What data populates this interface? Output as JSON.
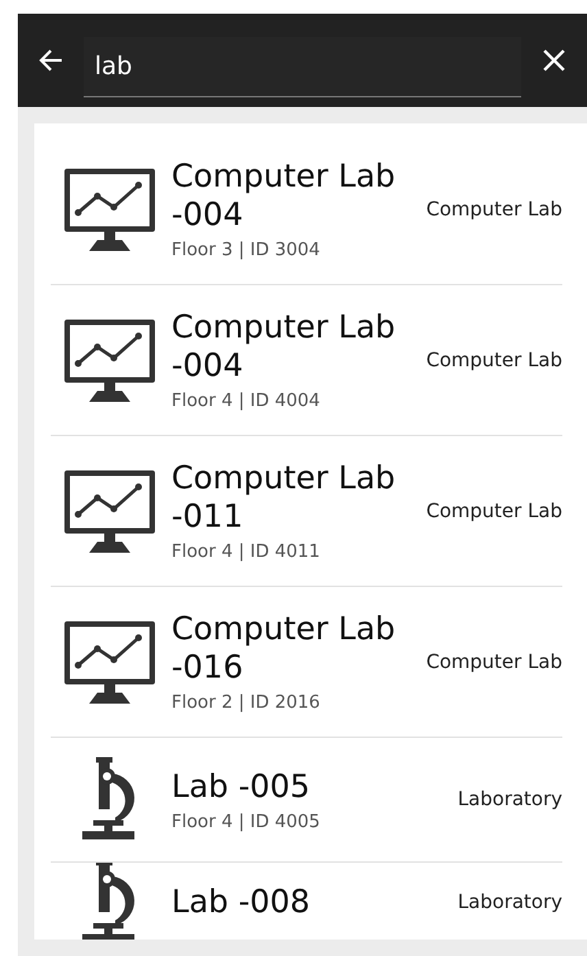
{
  "search": {
    "value": "lab"
  },
  "results": [
    {
      "kind": "computer",
      "title": "Computer Lab -004",
      "subtitle": "Floor 3 | ID 3004",
      "category": "Computer Lab"
    },
    {
      "kind": "computer",
      "title": "Computer Lab -004",
      "subtitle": "Floor 4 | ID 4004",
      "category": "Computer Lab"
    },
    {
      "kind": "computer",
      "title": "Computer Lab -011",
      "subtitle": "Floor 4 | ID 4011",
      "category": "Computer Lab"
    },
    {
      "kind": "computer",
      "title": "Computer Lab -016",
      "subtitle": "Floor 2 | ID 2016",
      "category": "Computer Lab"
    },
    {
      "kind": "microscope",
      "title": "Lab -005",
      "subtitle": "Floor 4 | ID 4005",
      "category": "Laboratory"
    },
    {
      "kind": "microscope",
      "title": "Lab -008",
      "category": "Laboratory"
    }
  ]
}
